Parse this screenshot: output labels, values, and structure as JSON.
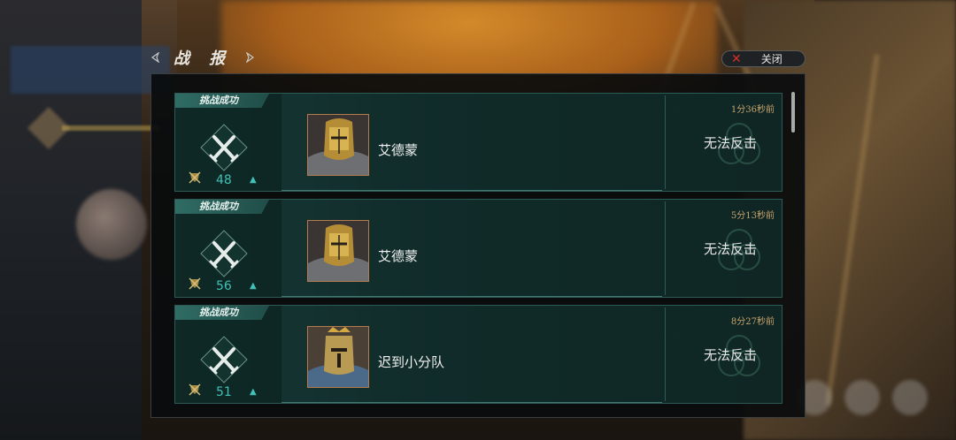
{
  "header": {
    "title": "战 报"
  },
  "close_button": {
    "label": "关闭"
  },
  "reports": [
    {
      "badge": "挑战成功",
      "score": "48",
      "opponent": "艾德蒙",
      "time_ago": "1分36秒前",
      "status": "无法反击",
      "portrait": "armored-knight-golden-helm"
    },
    {
      "badge": "挑战成功",
      "score": "56",
      "opponent": "艾德蒙",
      "time_ago": "5分13秒前",
      "status": "无法反击",
      "portrait": "armored-knight-golden-helm"
    },
    {
      "badge": "挑战成功",
      "score": "51",
      "opponent": "迟到小分队",
      "time_ago": "8分27秒前",
      "status": "无法反击",
      "portrait": "crowned-knight-great-helm"
    }
  ],
  "colors": {
    "accent_teal": "#40c1b6",
    "time_gold": "#c8a46e",
    "close_x": "#d3302a"
  }
}
